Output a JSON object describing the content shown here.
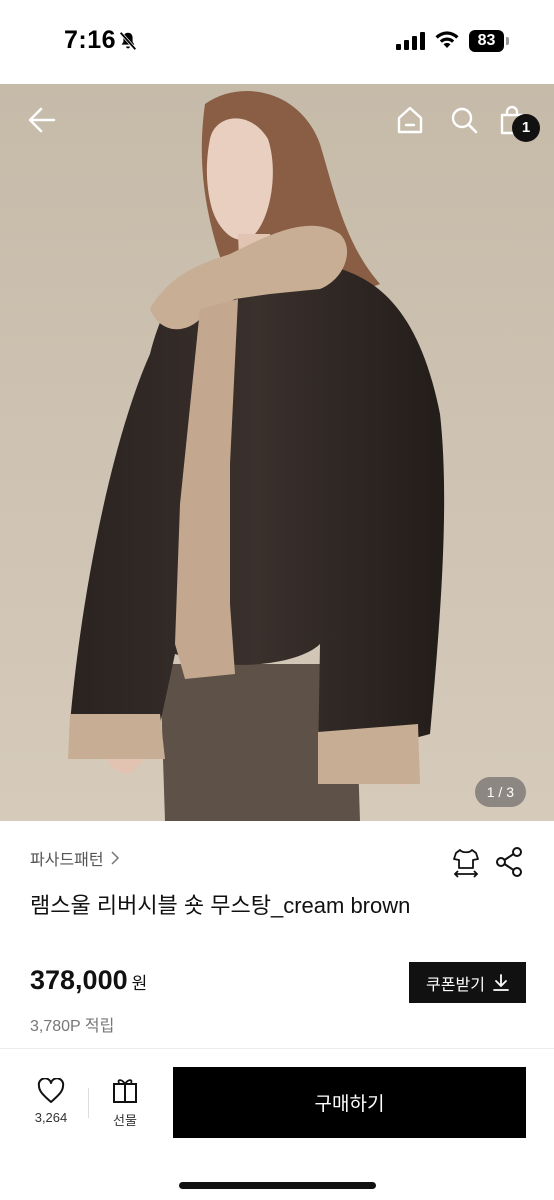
{
  "status_bar": {
    "time": "7:16",
    "battery": "83",
    "icons": [
      "bell-off-icon",
      "signal-icon",
      "wifi-icon",
      "battery-icon"
    ]
  },
  "hero": {
    "image_counter": "1 / 3",
    "cart_count": "1",
    "icons": [
      "back-arrow-icon",
      "home-icon",
      "search-icon",
      "cart-icon"
    ]
  },
  "product": {
    "brand": "파사드패턴",
    "title": "램스울 리버시블 숏 무스탕_cream brown",
    "price": "378,000",
    "price_unit": "원",
    "points": "3,780P 적립",
    "coupon_label": "쿠폰받기",
    "icons": [
      "size-guide-icon",
      "share-icon",
      "download-icon",
      "chevron-right-icon"
    ]
  },
  "bottom_bar": {
    "like_count": "3,264",
    "gift_label": "선물",
    "buy_label": "구매하기",
    "icons": [
      "heart-icon",
      "gift-icon"
    ]
  },
  "colors": {
    "primary": "#000000",
    "text_secondary": "#777777"
  }
}
